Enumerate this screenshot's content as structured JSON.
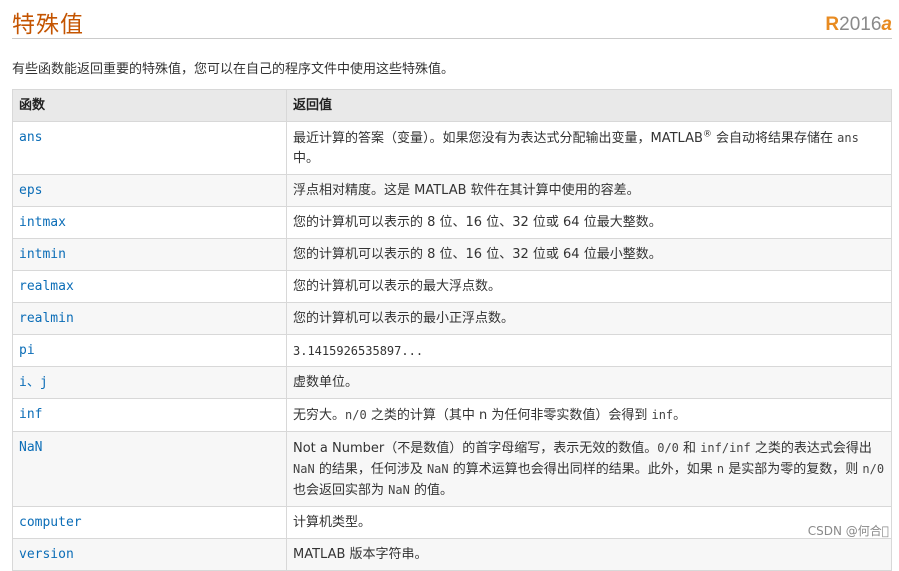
{
  "header": {
    "title": "特殊值",
    "release_prefix": "R",
    "release_year": "2016",
    "release_suffix": "a"
  },
  "intro": "有些函数能返回重要的特殊值，您可以在自己的程序文件中使用这些特殊值。",
  "table": {
    "columns": [
      "函数",
      "返回值"
    ],
    "rows": [
      {
        "fn": "ans",
        "value": "最近计算的答案（变量）。如果您没有为表达式分配输出变量，MATLAB® 会自动将结果存储在 ans 中。"
      },
      {
        "fn": "eps",
        "value": "浮点相对精度。这是 MATLAB 软件在其计算中使用的容差。"
      },
      {
        "fn": "intmax",
        "value": "您的计算机可以表示的 8 位、16 位、32 位或 64 位最大整数。"
      },
      {
        "fn": "intmin",
        "value": "您的计算机可以表示的 8 位、16 位、32 位或 64 位最小整数。"
      },
      {
        "fn": "realmax",
        "value": "您的计算机可以表示的最大浮点数。"
      },
      {
        "fn": "realmin",
        "value": "您的计算机可以表示的最小正浮点数。"
      },
      {
        "fn": "pi",
        "value": "3.1415926535897..."
      },
      {
        "fn": "i、j",
        "value": "虚数单位。"
      },
      {
        "fn": "inf",
        "value": "无穷大。n/0 之类的计算（其中 n 为任何非零实数值）会得到 inf。"
      },
      {
        "fn": "NaN",
        "value": "Not a Number（不是数值）的首字母缩写，表示无效的数值。0/0 和 inf/inf 之类的表达式会得出 NaN 的结果，任何涉及 NaN 的算术运算也会得出同样的结果。此外，如果 n 是实部为零的复数，则 n/0 也会返回实部为 NaN 的值。"
      },
      {
        "fn": "computer",
        "value": "计算机类型。"
      },
      {
        "fn": "version",
        "value": "MATLAB 版本字符串。"
      }
    ]
  },
  "watermark": "CSDN @何合\u0000"
}
